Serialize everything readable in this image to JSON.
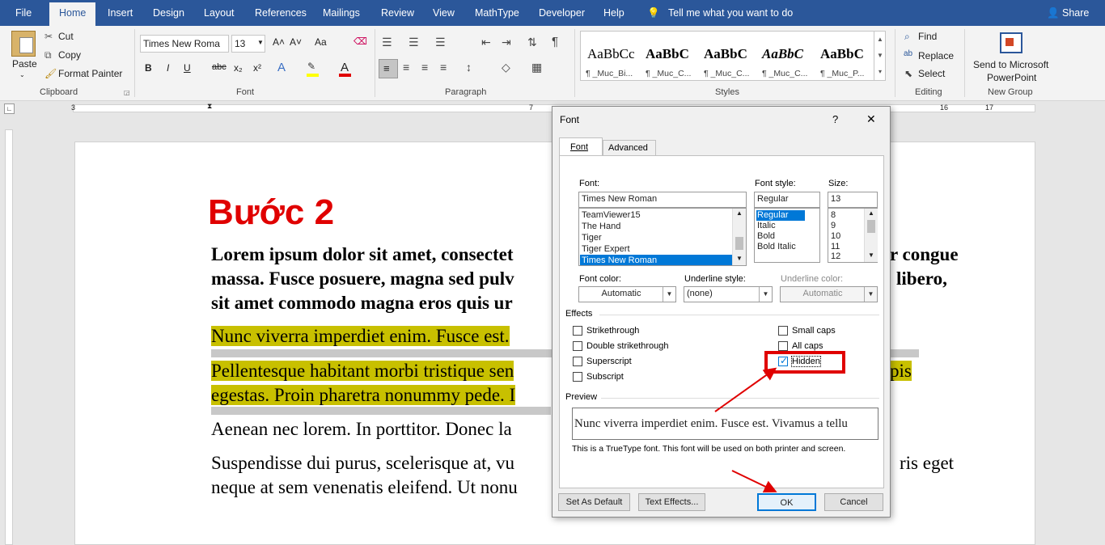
{
  "tabs": {
    "file": "File",
    "home": "Home",
    "insert": "Insert",
    "design": "Design",
    "layout": "Layout",
    "references": "References",
    "mailings": "Mailings",
    "review": "Review",
    "view": "View",
    "mathtype": "MathType",
    "developer": "Developer",
    "help": "Help",
    "tellme": "Tell me what you want to do",
    "share": "Share"
  },
  "clipboard": {
    "paste": "Paste",
    "cut": "Cut",
    "copy": "Copy",
    "format_painter": "Format Painter",
    "label": "Clipboard"
  },
  "font_group": {
    "font_name": "Times New Roma",
    "font_size": "13",
    "label": "Font",
    "bold": "B",
    "italic": "I",
    "underline": "U",
    "strike": "abc",
    "sub": "x₂",
    "sup": "x²",
    "grow": "A˄",
    "shrink": "A˅",
    "case": "Aa"
  },
  "paragraph": {
    "label": "Paragraph"
  },
  "styles": {
    "label": "Styles",
    "items": [
      {
        "sample": "AaBbCc",
        "name": "¶ _Muc_Bi..."
      },
      {
        "sample": "AaBbC",
        "name": "¶ _Muc_C..."
      },
      {
        "sample": "AaBbC",
        "name": "¶ _Muc_C..."
      },
      {
        "sample": "AaBbC",
        "name": "¶ _Muc_C..."
      },
      {
        "sample": "AaBbC",
        "name": "¶ _Muc_P..."
      }
    ]
  },
  "editing": {
    "find": "Find",
    "replace": "Replace",
    "select": "Select",
    "label": "Editing"
  },
  "newgroup": {
    "send_line1": "Send to Microsoft",
    "send_line2": "PowerPoint",
    "label": "New Group"
  },
  "ruler": {
    "t3": "3",
    "t16": "16",
    "t17": "17",
    "t7": "7"
  },
  "doc": {
    "heading": "Bước 2",
    "p1_l1": "Lorem ipsum dolor sit amet, consectet",
    "p1_l1b": "r congue",
    "p1_l2": "massa. Fusce posuere, magna sed pulv",
    "p1_l2b": "libero,",
    "p1_l3": "sit amet commodo magna eros quis ur",
    "p2": "Nunc viverra imperdiet enim. Fusce est.",
    "p3_l1": "Pellentesque habitant morbi tristique sen",
    "p3_l1b": "pis",
    "p3_l2": "egestas. Proin pharetra nonummy pede. I",
    "p4": "Aenean nec lorem. In porttitor. Donec la",
    "p5_l1": "Suspendisse dui purus, scelerisque at, vu",
    "p5_l1b": "ris eget",
    "p5_l2": "neque at sem venenatis eleifend. Ut nonu"
  },
  "dialog": {
    "title": "Font",
    "help": "?",
    "close": "✕",
    "tab_font": "Font",
    "tab_advanced": "Advanced",
    "font_label": "Font:",
    "font_value": "Times New Roman",
    "font_list": [
      "TeamViewer15",
      "The Hand",
      "Tiger",
      "Tiger Expert",
      "Times New Roman"
    ],
    "style_label": "Font style:",
    "style_value": "Regular",
    "style_list": [
      "Regular",
      "Italic",
      "Bold",
      "Bold Italic"
    ],
    "size_label": "Size:",
    "size_value": "13",
    "size_list": [
      "8",
      "9",
      "10",
      "11",
      "12"
    ],
    "fontcolor_label": "Font color:",
    "fontcolor_value": "Automatic",
    "underline_label": "Underline style:",
    "underline_value": "(none)",
    "ucolor_label": "Underline color:",
    "ucolor_value": "Automatic",
    "effects_label": "Effects",
    "strikethrough": "Strikethrough",
    "double_strikethrough": "Double strikethrough",
    "superscript": "Superscript",
    "subscript": "Subscript",
    "small_caps": "Small caps",
    "all_caps": "All caps",
    "hidden": "Hidden",
    "preview_label": "Preview",
    "preview_text": "Nunc viverra imperdiet enim. Fusce est. Vivamus a tellu",
    "truetype_note": "This is a TrueType font. This font will be used on both printer and screen.",
    "set_default": "Set As Default",
    "text_effects": "Text Effects...",
    "ok": "OK",
    "cancel": "Cancel"
  },
  "colors": {
    "accent": "#2b579a",
    "annotation_red": "#e00000",
    "highlight": "#c8c000"
  }
}
